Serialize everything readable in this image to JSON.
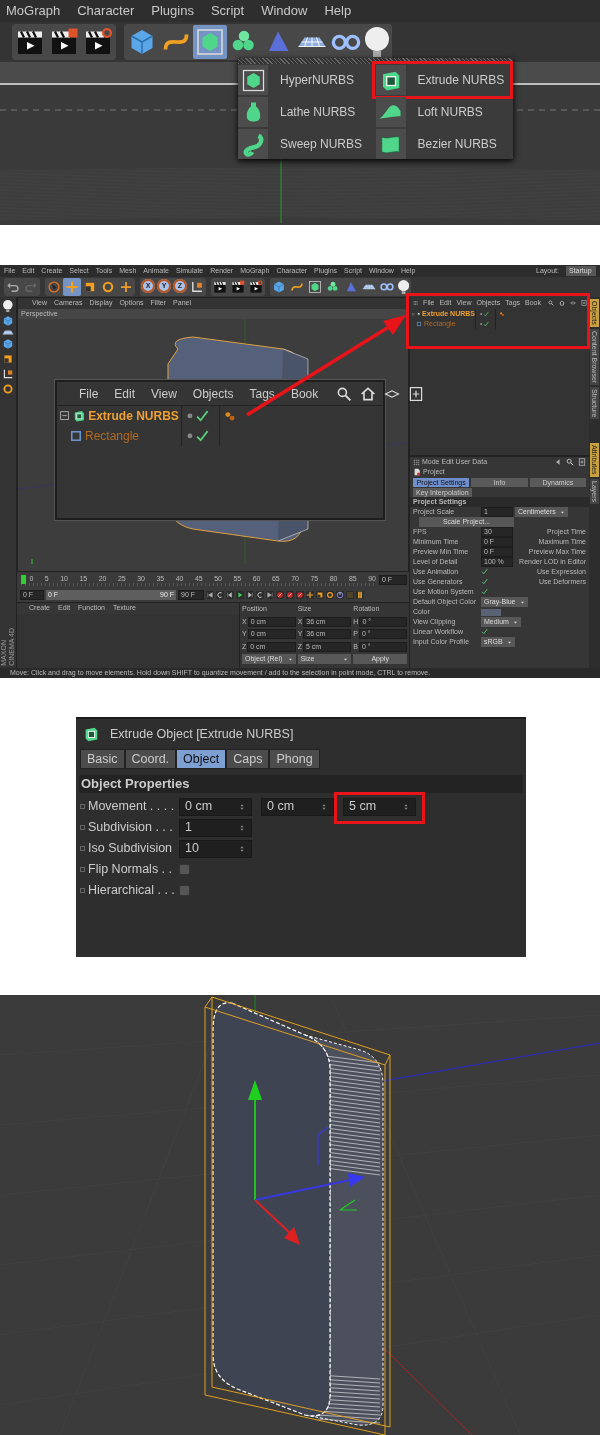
{
  "menu_step": {
    "menu_bar": [
      "MoGraph",
      "Character",
      "Plugins",
      "Script",
      "Window",
      "Help"
    ],
    "toolbar_groups": [
      [
        {
          "kind": "clapper",
          "selected": false
        },
        {
          "kind": "clapperRed",
          "selected": false
        },
        {
          "kind": "clapperGear",
          "selected": false
        }
      ],
      [
        {
          "kind": "cube",
          "selected": false
        },
        {
          "kind": "spline",
          "selected": false
        },
        {
          "kind": "nurbs",
          "selected": true
        },
        {
          "kind": "cloner",
          "selected": false
        },
        {
          "kind": "deformer",
          "selected": false
        },
        {
          "kind": "floor",
          "selected": false
        },
        {
          "kind": "camera",
          "selected": false
        },
        {
          "kind": "light",
          "selected": false
        }
      ]
    ],
    "nurbs_menu": [
      {
        "label": "HyperNURBS",
        "kind": "hyper",
        "annotated": false
      },
      {
        "label": "Extrude NURBS",
        "kind": "extrude",
        "annotated": true
      },
      {
        "label": "Lathe NURBS",
        "kind": "lathe",
        "annotated": false
      },
      {
        "label": "Loft NURBS",
        "kind": "loft",
        "annotated": false
      },
      {
        "label": "Sweep NURBS",
        "kind": "sweep",
        "annotated": false
      },
      {
        "label": "Bezier NURBS",
        "kind": "bezier",
        "annotated": false
      }
    ]
  },
  "interface_step": {
    "menu_bar": [
      "File",
      "Edit",
      "Create",
      "Select",
      "Tools",
      "Mesh",
      "Animate",
      "Simulate",
      "Render",
      "MoGraph",
      "Character",
      "Plugins",
      "Script",
      "Window",
      "Help"
    ],
    "layout_label": "Layout:",
    "layout_value": "Startup",
    "toolbar_groups": [
      [
        {
          "kind": "undo",
          "selected": false
        },
        {
          "kind": "redo",
          "selected": false
        }
      ],
      [
        {
          "kind": "select",
          "selected": false
        },
        {
          "kind": "move",
          "selected": true
        },
        {
          "kind": "scale",
          "selected": false
        },
        {
          "kind": "rotate",
          "selected": false
        },
        {
          "kind": "add",
          "selected": false
        }
      ],
      [
        {
          "kind": "axis",
          "label": "X",
          "selected": true
        },
        {
          "kind": "axis",
          "label": "Y",
          "selected": true
        },
        {
          "kind": "axis",
          "label": "Z",
          "selected": true
        },
        {
          "kind": "coord",
          "selected": false
        }
      ],
      [
        {
          "kind": "clapper",
          "selected": false
        },
        {
          "kind": "clapperRed",
          "selected": false
        },
        {
          "kind": "clapperGear",
          "selected": false
        }
      ],
      [
        {
          "kind": "cube",
          "selected": false
        },
        {
          "kind": "spline",
          "selected": false
        },
        {
          "kind": "nurbs",
          "selected": false
        },
        {
          "kind": "cloner",
          "selected": false
        },
        {
          "kind": "deformer",
          "selected": false
        },
        {
          "kind": "floor",
          "selected": false
        },
        {
          "kind": "camera",
          "selected": false
        },
        {
          "kind": "light",
          "selected": false
        }
      ]
    ],
    "viewport_menu": [
      "View",
      "Cameras",
      "Display",
      "Options",
      "Filter",
      "Panel"
    ],
    "viewport_title": "Perspective",
    "object_manager_zoom": {
      "menu": [
        "File",
        "Edit",
        "View",
        "Objects",
        "Tags",
        "Book"
      ],
      "tree": [
        {
          "name": "Extrude NURBS",
          "kind": "extrude",
          "selected": true,
          "enabled": true,
          "tagged": true,
          "children": [
            {
              "name": "Rectangle",
              "kind": "rect",
              "selected": false,
              "enabled": true,
              "tagged": false
            }
          ]
        }
      ]
    },
    "objects_panel": {
      "menu": [
        "File",
        "Edit",
        "View",
        "Objects",
        "Tags",
        "Book"
      ],
      "tree": [
        {
          "name": "Extrude NURBS",
          "kind": "extrude",
          "selected": true,
          "enabled": true,
          "tagged": true,
          "children": [
            {
              "name": "Rectangle",
              "kind": "rect",
              "selected": false,
              "enabled": true,
              "tagged": false
            }
          ]
        }
      ]
    },
    "side_tabs_top": [
      {
        "label": "Objects",
        "selected": true
      },
      {
        "label": "Content Browser",
        "selected": false
      },
      {
        "label": "Structure",
        "selected": false
      }
    ],
    "side_tabs_bottom": [
      {
        "label": "Attributes",
        "selected": true
      },
      {
        "label": "Layers",
        "selected": false
      }
    ],
    "attributes": {
      "menu": [
        "Mode",
        "Edit",
        "User Data"
      ],
      "object": "Project",
      "tabs": [
        {
          "label": "Project Settings",
          "selected": true
        },
        {
          "label": "Info",
          "selected": false
        },
        {
          "label": "Dynamics",
          "selected": false
        },
        {
          "label": "Key Interpolation",
          "selected": false
        }
      ],
      "section": "Project Settings",
      "rows": [
        {
          "kind": "field",
          "label": "Project Scale",
          "value": "1",
          "dropdown": "Centimeters"
        },
        {
          "kind": "button",
          "label": "Scale Project..."
        },
        {
          "kind": "field",
          "label": "FPS",
          "value": "30",
          "right": "Project Time"
        },
        {
          "kind": "field",
          "label": "Minimum Time",
          "value": "0 F",
          "right": "Maximum Time"
        },
        {
          "kind": "field",
          "label": "Preview Min Time",
          "value": "0 F",
          "right": "Preview Max Time"
        },
        {
          "kind": "field",
          "label": "Level of Detail",
          "value": "100 %",
          "right": "Render LOD in Editor"
        },
        {
          "kind": "check",
          "label": "Use Animation",
          "checked": true,
          "right": "Use Expression"
        },
        {
          "kind": "check",
          "label": "Use Generators",
          "checked": true,
          "right": "Use Deformers"
        },
        {
          "kind": "check",
          "label": "Use Motion System",
          "checked": true
        },
        {
          "kind": "dropdown",
          "label": "Default Object Color",
          "value": "Gray-Blue"
        },
        {
          "kind": "swatch",
          "label": "Color"
        },
        {
          "kind": "dropdown",
          "label": "View Clipping",
          "value": "Medium"
        },
        {
          "kind": "check",
          "label": "Linear Workflow",
          "checked": true
        },
        {
          "kind": "dropdown",
          "label": "Input Color Profile",
          "value": "sRGB"
        }
      ]
    },
    "ruler": [
      "0",
      "5",
      "10",
      "15",
      "20",
      "25",
      "30",
      "35",
      "40",
      "45",
      "50",
      "55",
      "60",
      "65",
      "70",
      "75",
      "80",
      "85",
      "90"
    ],
    "ruler_field": "0 F",
    "start_field": "0 F",
    "range_slider": {
      "start": "0 F",
      "end": "90 F",
      "level": 1
    },
    "end_field": "90 F",
    "material_menu": [
      "Create",
      "Edit",
      "Function",
      "Texture"
    ],
    "coordinates": {
      "headers": [
        "Position",
        "Size",
        "Rotation"
      ],
      "rows": [
        [
          {
            "axis": "X",
            "value": "0 cm"
          },
          {
            "axis": "X",
            "value": "36 cm"
          },
          {
            "axis": "H",
            "value": "0 °"
          }
        ],
        [
          {
            "axis": "Y",
            "value": "0 cm"
          },
          {
            "axis": "Y",
            "value": "36 cm"
          },
          {
            "axis": "P",
            "value": "0 °"
          }
        ],
        [
          {
            "axis": "Z",
            "value": "0 cm"
          },
          {
            "axis": "Z",
            "value": "5 cm"
          },
          {
            "axis": "B",
            "value": "0 °"
          }
        ]
      ],
      "mode": "Object (Rel)",
      "size_mode": "Size",
      "apply": "Apply"
    },
    "logo": [
      "MAXON",
      "CINEMA 4D"
    ],
    "status": "Move: Click and drag to move elements. Hold down SHIFT to quantize movement / add to the selection in point mode, CTRL to remove."
  },
  "extrude_attributes": {
    "title": "Extrude Object [Extrude NURBS]",
    "tabs": [
      {
        "label": "Basic",
        "selected": false
      },
      {
        "label": "Coord.",
        "selected": false
      },
      {
        "label": "Object",
        "selected": true
      },
      {
        "label": "Caps",
        "selected": false
      },
      {
        "label": "Phong",
        "selected": false
      }
    ],
    "section": "Object Properties",
    "rows": [
      {
        "kind": "fields",
        "label": "Movement . . . .",
        "values": [
          {
            "value": "0 cm",
            "annotated": false
          },
          {
            "value": "0 cm",
            "annotated": false
          },
          {
            "value": "5 cm",
            "annotated": true
          }
        ]
      },
      {
        "kind": "fields",
        "label": "Subdivision . . .",
        "values": [
          {
            "value": "1",
            "annotated": false
          }
        ]
      },
      {
        "kind": "fields",
        "label": "Iso Subdivision",
        "values": [
          {
            "value": "10",
            "annotated": false
          }
        ]
      },
      {
        "kind": "checkbox",
        "label": "Flip Normals . .",
        "checked": false
      },
      {
        "kind": "checkbox",
        "label": "Hierarchical . . .",
        "checked": false
      }
    ]
  }
}
